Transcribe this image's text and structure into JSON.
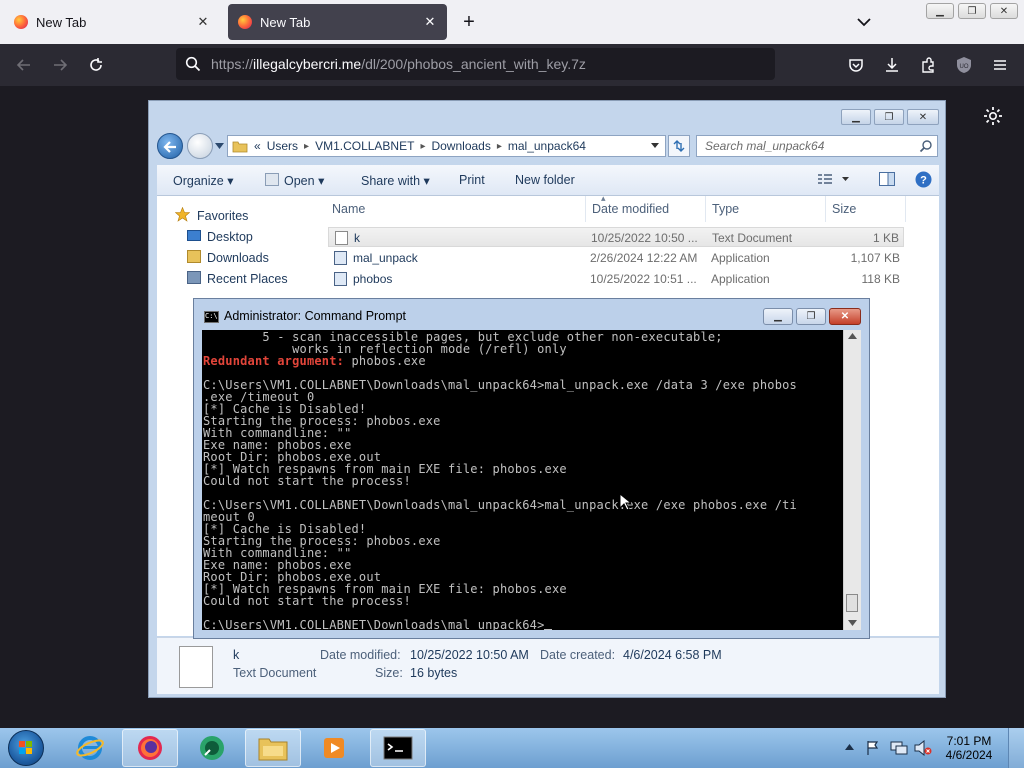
{
  "browser": {
    "tabs": [
      {
        "title": "New Tab",
        "active": false
      },
      {
        "title": "New Tab",
        "active": true
      }
    ],
    "url_prefix": "https://",
    "url_domain": "illegalcybercri.me",
    "url_path": "/dl/200/phobos_ancient_with_key.7z"
  },
  "explorer": {
    "breadcrumb": [
      "«",
      "Users",
      "VM1.COLLABNET",
      "Downloads",
      "mal_unpack64"
    ],
    "search_placeholder": "Search mal_unpack64",
    "toolbar": {
      "organize": "Organize",
      "open": "Open",
      "share_with": "Share with",
      "print": "Print",
      "new_folder": "New folder"
    },
    "nav": {
      "favorites": "Favorites",
      "items": [
        "Desktop",
        "Downloads",
        "Recent Places"
      ]
    },
    "columns": {
      "name": "Name",
      "date": "Date modified",
      "type": "Type",
      "size": "Size"
    },
    "files": [
      {
        "name": "k",
        "date": "10/25/2022 10:50 ...",
        "type": "Text Document",
        "size": "1 KB",
        "selected": true
      },
      {
        "name": "mal_unpack",
        "date": "2/26/2024 12:22 AM",
        "type": "Application",
        "size": "1,107 KB",
        "selected": false
      },
      {
        "name": "phobos",
        "date": "10/25/2022 10:51 ...",
        "type": "Application",
        "size": "118 KB",
        "selected": false
      }
    ],
    "details": {
      "name": "k",
      "type": "Text Document",
      "date_modified_label": "Date modified:",
      "date_modified": "10/25/2022 10:50 AM",
      "date_created_label": "Date created:",
      "date_created": "4/6/2024 6:58 PM",
      "size_label": "Size:",
      "size": "16 bytes"
    }
  },
  "cmd": {
    "title": "Administrator: Command Prompt",
    "lines": [
      {
        "text": "        5 - scan inaccessible pages, but exclude other non-executable;",
        "style": "normal"
      },
      {
        "text": "            works in reflection mode (/refl) only",
        "style": "normal"
      },
      {
        "text": "Redundant argument:",
        "style": "red",
        "rest": " phobos.exe"
      },
      {
        "text": "",
        "style": "normal"
      },
      {
        "text": "C:\\Users\\VM1.COLLABNET\\Downloads\\mal_unpack64>mal_unpack.exe /data 3 /exe phobos",
        "style": "normal"
      },
      {
        "text": ".exe /timeout 0",
        "style": "normal"
      },
      {
        "text": "[*] Cache is Disabled!",
        "style": "normal"
      },
      {
        "text": "Starting the process: phobos.exe",
        "style": "normal"
      },
      {
        "text": "With commandline: \"\"",
        "style": "normal"
      },
      {
        "text": "Exe name: phobos.exe",
        "style": "normal"
      },
      {
        "text": "Root Dir: phobos.exe.out",
        "style": "normal"
      },
      {
        "text": "[*] Watch respawns from main EXE file: phobos.exe",
        "style": "normal"
      },
      {
        "text": "Could not start the process!",
        "style": "normal"
      },
      {
        "text": "",
        "style": "normal"
      },
      {
        "text": "C:\\Users\\VM1.COLLABNET\\Downloads\\mal_unpack64>mal_unpack.exe /exe phobos.exe /ti",
        "style": "normal"
      },
      {
        "text": "meout 0",
        "style": "normal"
      },
      {
        "text": "[*] Cache is Disabled!",
        "style": "normal"
      },
      {
        "text": "Starting the process: phobos.exe",
        "style": "normal"
      },
      {
        "text": "With commandline: \"\"",
        "style": "normal"
      },
      {
        "text": "Exe name: phobos.exe",
        "style": "normal"
      },
      {
        "text": "Root Dir: phobos.exe.out",
        "style": "normal"
      },
      {
        "text": "[*] Watch respawns from main EXE file: phobos.exe",
        "style": "normal"
      },
      {
        "text": "Could not start the process!",
        "style": "normal"
      },
      {
        "text": "",
        "style": "normal"
      },
      {
        "text": "C:\\Users\\VM1.COLLABNET\\Downloads\\mal_unpack64>",
        "style": "normal"
      }
    ]
  },
  "taskbar": {
    "apps": [
      "internet-explorer-icon",
      "firefox-icon",
      "app-icon",
      "windows-explorer-icon",
      "media-player-icon",
      "command-prompt-icon"
    ],
    "time": "7:01 PM",
    "date": "4/6/2024"
  },
  "colors": {
    "cmd_error": "#e2453a",
    "firefox_toolbar": "#2b2a33",
    "taskbar": "#9cc6ec"
  }
}
